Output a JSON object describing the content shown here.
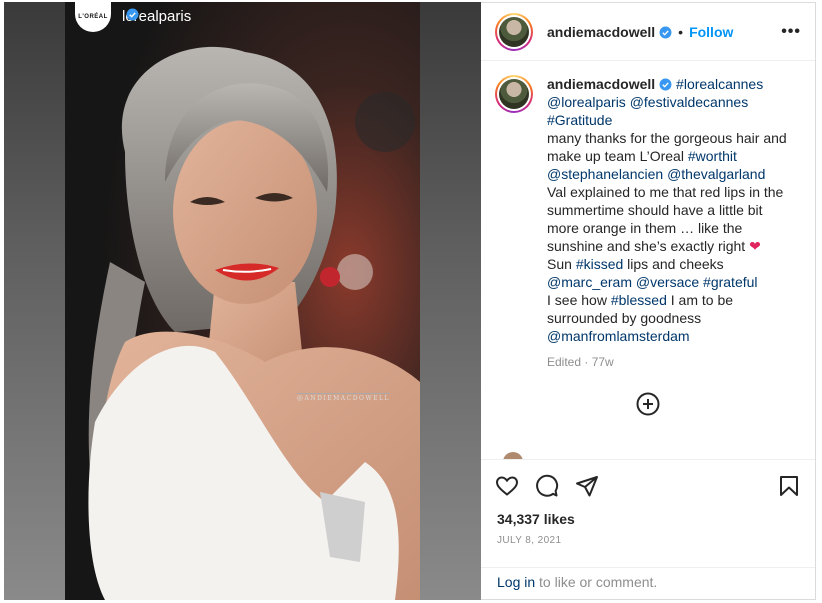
{
  "colors": {
    "link": "#00376b",
    "follow": "#0095f6",
    "muted": "#8e8e8e",
    "heart": "#e0245e"
  },
  "media": {
    "story_account": "lorealparis",
    "story_logo_text": "L'ORÉAL",
    "watermark": "@ANDIEMACDOWELL"
  },
  "header": {
    "username": "andiemacdowell",
    "separator": "•",
    "follow_label": "Follow",
    "more_icon": "more-horizontal-icon"
  },
  "caption": {
    "username": "andiemacdowell",
    "segments": [
      {
        "t": "link",
        "v": "#lorealcannes"
      },
      {
        "t": "text",
        "v": " "
      },
      {
        "t": "link",
        "v": "@lorealparis"
      },
      {
        "t": "text",
        "v": " "
      },
      {
        "t": "link",
        "v": "@festivaldecannes"
      },
      {
        "t": "text",
        "v": " "
      },
      {
        "t": "link",
        "v": "#Gratitude"
      },
      {
        "t": "br"
      },
      {
        "t": "text",
        "v": "many thanks for the gorgeous hair and make up team L’Oreal "
      },
      {
        "t": "link",
        "v": "#worthit"
      },
      {
        "t": "text",
        "v": " "
      },
      {
        "t": "link",
        "v": "@stephanelancien"
      },
      {
        "t": "text",
        "v": " "
      },
      {
        "t": "link",
        "v": "@thevalgarland"
      },
      {
        "t": "br"
      },
      {
        "t": "text",
        "v": "Val explained to me that red lips in the summertime should have a little bit more orange in them … like the sunshine and she’s exactly right ❤️"
      },
      {
        "t": "br"
      },
      {
        "t": "text",
        "v": "Sun "
      },
      {
        "t": "link",
        "v": "#kissed"
      },
      {
        "t": "text",
        "v": " lips and cheeks"
      },
      {
        "t": "br"
      },
      {
        "t": "link",
        "v": "@marc_eram"
      },
      {
        "t": "text",
        "v": " "
      },
      {
        "t": "link",
        "v": "@versace"
      },
      {
        "t": "text",
        "v": " "
      },
      {
        "t": "link",
        "v": "#grateful"
      },
      {
        "t": "br"
      },
      {
        "t": "text",
        "v": "I see how "
      },
      {
        "t": "link",
        "v": "#blessed"
      },
      {
        "t": "text",
        "v": " I am to be surrounded by goodness"
      },
      {
        "t": "br"
      },
      {
        "t": "link",
        "v": "@manfromlamsterdam"
      }
    ],
    "meta": "Edited · 77w"
  },
  "actions": {
    "icons": [
      "heart-icon",
      "comment-icon",
      "share-icon",
      "bookmark-icon"
    ]
  },
  "likes_label": "34,337 likes",
  "date_label": "JULY 8, 2021",
  "footer": {
    "login_link": "Log in",
    "login_rest": " to like or comment."
  }
}
